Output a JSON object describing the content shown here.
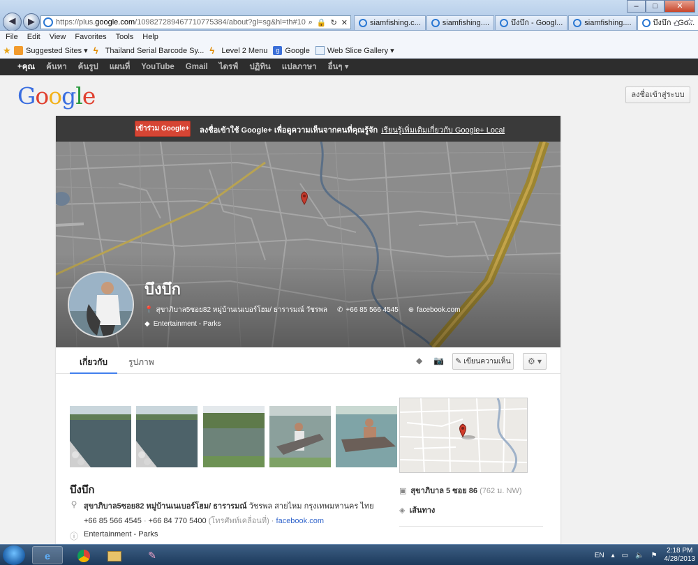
{
  "browser": {
    "url_prefix": "https://plus.",
    "url_domain": "google.com",
    "url_rest": "/109827289467710775384/about?gl=sg&hl=th#10982728946771",
    "tabs": [
      {
        "label": "siamfishing.c...",
        "active": false
      },
      {
        "label": "siamfishing....",
        "active": false
      },
      {
        "label": "บึงบึก - Googl...",
        "active": false
      },
      {
        "label": "siamfishing....",
        "active": false
      },
      {
        "label": "บึงบึก - Go...",
        "active": true
      }
    ],
    "menu": [
      "File",
      "Edit",
      "View",
      "Favorites",
      "Tools",
      "Help"
    ],
    "favorites": [
      {
        "label": "Suggested Sites ▾",
        "icon": "orange"
      },
      {
        "label": "Thailand Serial Barcode Sy...",
        "icon": "bolt"
      },
      {
        "label": "Level 2 Menu",
        "icon": "bolt"
      },
      {
        "label": "Google",
        "icon": "g"
      },
      {
        "label": "Web Slice Gallery ▾",
        "icon": "slice"
      }
    ]
  },
  "gbar": [
    "+คุณ",
    "ค้นหา",
    "ค้นรูป",
    "แผนที่",
    "YouTube",
    "Gmail",
    "ไดรฟ์",
    "ปฏิทิน",
    "แปลภาษา",
    "อื่นๆ ▾"
  ],
  "header": {
    "logo": [
      "G",
      "o",
      "o",
      "g",
      "l",
      "e"
    ],
    "signin": "ลงชื่อเข้าสู่ระบบ"
  },
  "joinbar": {
    "button": "เข้าร่วม Google+",
    "text": "ลงชื่อเข้าใช้ Google+ เพื่อดูความเห็นจากคนที่คุณรู้จัก",
    "link": "เรียนรู้เพิ่มเติมเกี่ยวกับ Google+ Local"
  },
  "profile": {
    "name": "บึงบึก",
    "address": "สุขาภิบาล5ซอย82 หมู่บ้านเนเบอร์โฮม/ ธารารมณ์ วัชรพล",
    "phone": "+66 85 566 4545",
    "web": "facebook.com",
    "category": "Entertainment - Parks"
  },
  "tabs": {
    "about": "เกี่ยวกับ",
    "photos": "รูปภาพ",
    "review": "เขียนความเห็น"
  },
  "details": {
    "name": "บึงบึก",
    "address_bold": "สุขาภิบาล5ซอย82 หมู่บ้านเนเบอร์โฮม/ ธารารมณ์",
    "address_rest": " วัชรพล สายไหม กรุงเทพมหานคร ไทย",
    "phone1": "+66 85 566 4545",
    "sep": " · ",
    "phone2": "+66 84 770 5400",
    "phone2_note": " (โทรศัพท์เคลื่อนที่)",
    "web": "facebook.com",
    "category": "Entertainment - Parks"
  },
  "side": {
    "transit": "สุขาภิบาล 5 ซอย 86",
    "transit_dist": " (762 ม. NW)",
    "directions": "เส้นทาง"
  },
  "taskbar": {
    "lang": "EN",
    "time": "2:18 PM",
    "date": "4/28/2013"
  },
  "colors": {
    "join": "#d64534",
    "link": "#3366cc",
    "tab_underline": "#427fed",
    "gbar": "#2d2d2d"
  }
}
